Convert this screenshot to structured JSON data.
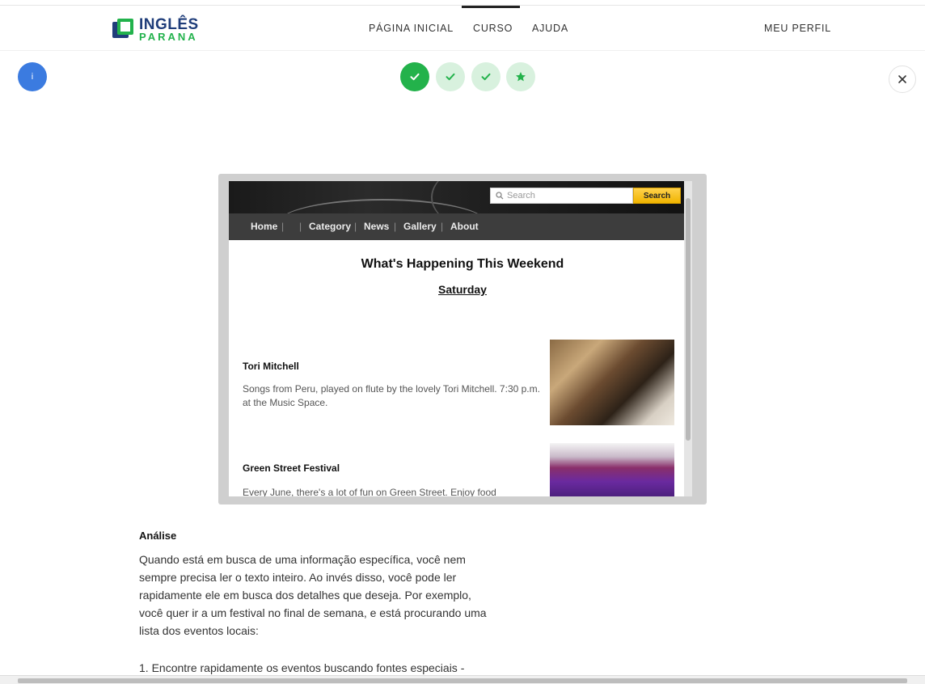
{
  "header": {
    "logo_line1": "INGLÊS",
    "logo_line2": "PARANA",
    "nav": [
      "PÁGINA INICIAL",
      "CURSO",
      "AJUDA"
    ],
    "profile": "MEU PERFIL"
  },
  "progress": {
    "info_label": "i",
    "steps": [
      {
        "icon": "check-icon",
        "state": "current"
      },
      {
        "icon": "check-icon",
        "state": "done"
      },
      {
        "icon": "check-icon",
        "state": "done"
      },
      {
        "icon": "star-icon",
        "state": "done"
      }
    ]
  },
  "website": {
    "search_placeholder": "Search",
    "search_button": "Search",
    "nav": [
      "Home",
      "Category",
      "News",
      "Gallery",
      "About"
    ],
    "title": "What's Happening This Weekend",
    "subtitle": "Saturday",
    "events": [
      {
        "title": "Tori Mitchell",
        "desc": "Songs from Peru, played on flute by the lovely Tori Mitchell. 7:30 p.m. at the Music Space."
      },
      {
        "title": "Green Street Festival",
        "desc": "Every June, there's a lot of fun on Green Street. Enjoy food"
      }
    ]
  },
  "analysis": {
    "heading": "Análise",
    "paragraph": "Quando está em busca de uma informação específica, você nem sempre precisa ler o texto inteiro. Ao invés disso, você pode ler rapidamente ele em busca dos detalhes que deseja. Por exemplo, você quer ir a um festival no final de semana, e está procurando uma lista dos eventos locais:",
    "list_item_1": "1. Encontre rapidamente os eventos buscando fontes especiais -"
  },
  "colors": {
    "brand_blue": "#1f3d7a",
    "brand_green": "#22b24c",
    "step_green": "#23b24b",
    "info_blue": "#3b7be0",
    "search_yellow": "#f0b400"
  }
}
